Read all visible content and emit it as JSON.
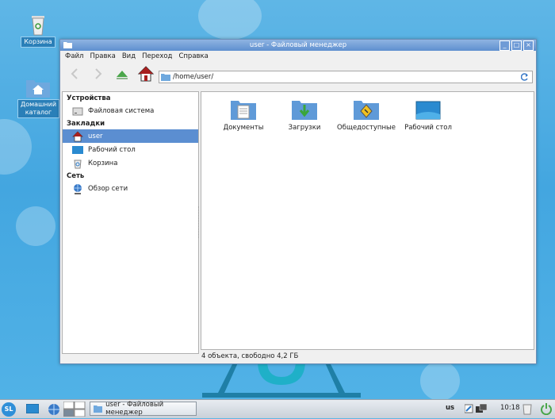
{
  "desktop": {
    "icons": [
      {
        "label": "Корзина"
      },
      {
        "label": "Домашний каталог"
      }
    ]
  },
  "window": {
    "title": "user - Файловый менеджер",
    "buttons": [
      "_",
      "□",
      "×"
    ],
    "menu": [
      "Файл",
      "Правка",
      "Вид",
      "Переход",
      "Справка"
    ],
    "address": "/home/user/",
    "sidebar": {
      "devices_header": "Устройства",
      "filesystem": "Файловая система",
      "bookmarks_header": "Закладки",
      "user": "user",
      "desktop": "Рабочий стол",
      "trash": "Корзина",
      "network_header": "Сеть",
      "network_browse": "Обзор сети"
    },
    "files": [
      {
        "name": "Документы"
      },
      {
        "name": "Загрузки"
      },
      {
        "name": "Общедоступные"
      },
      {
        "name": "Рабочий стол"
      }
    ],
    "status": "4 объекта, свободно 4,2 ГБ"
  },
  "taskbar": {
    "start": "SL",
    "task_label": "user - Файловый менеджер",
    "keyboard_layout": "us",
    "clock": "10:18"
  }
}
